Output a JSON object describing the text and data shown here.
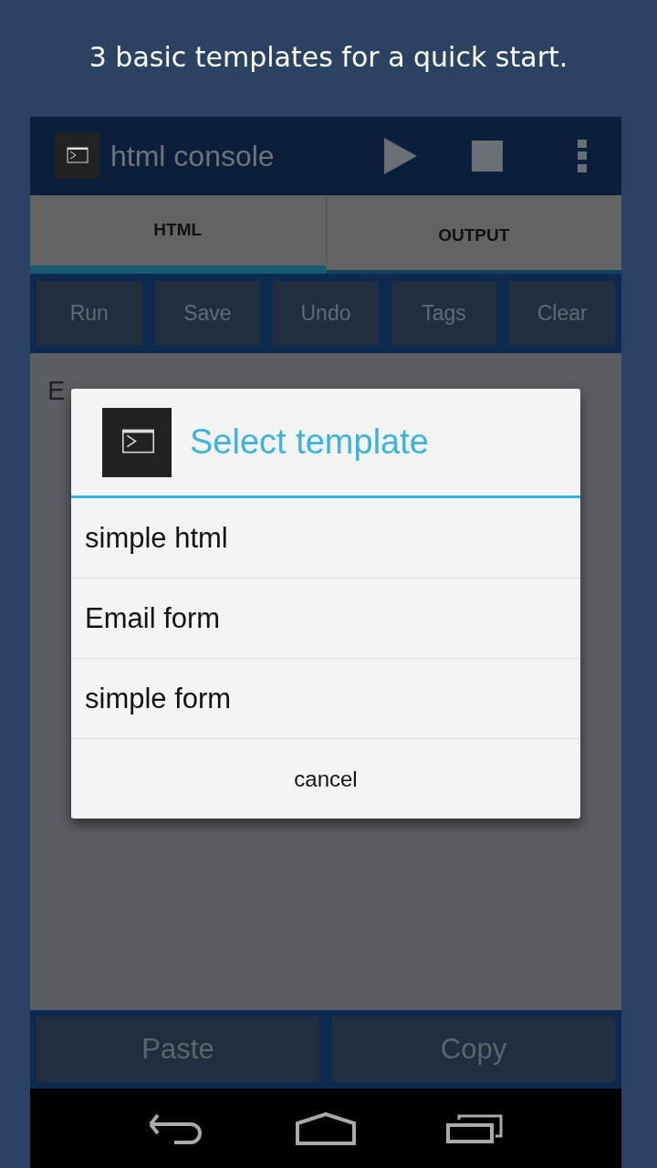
{
  "caption": "3 basic templates for a quick start.",
  "app_bar": {
    "title": "html console"
  },
  "tabs": [
    {
      "label": "HTML",
      "selected": true
    },
    {
      "label": "OUTPUT",
      "selected": false
    }
  ],
  "toolbar": [
    "Run",
    "Save",
    "Undo",
    "Tags",
    "Clear"
  ],
  "editor": {
    "placeholder": "E"
  },
  "dialog": {
    "title": "Select template",
    "items": [
      "simple html",
      "Email form",
      "simple form"
    ],
    "cancel": "cancel"
  },
  "bottom_buttons": [
    "Paste",
    "Copy"
  ]
}
